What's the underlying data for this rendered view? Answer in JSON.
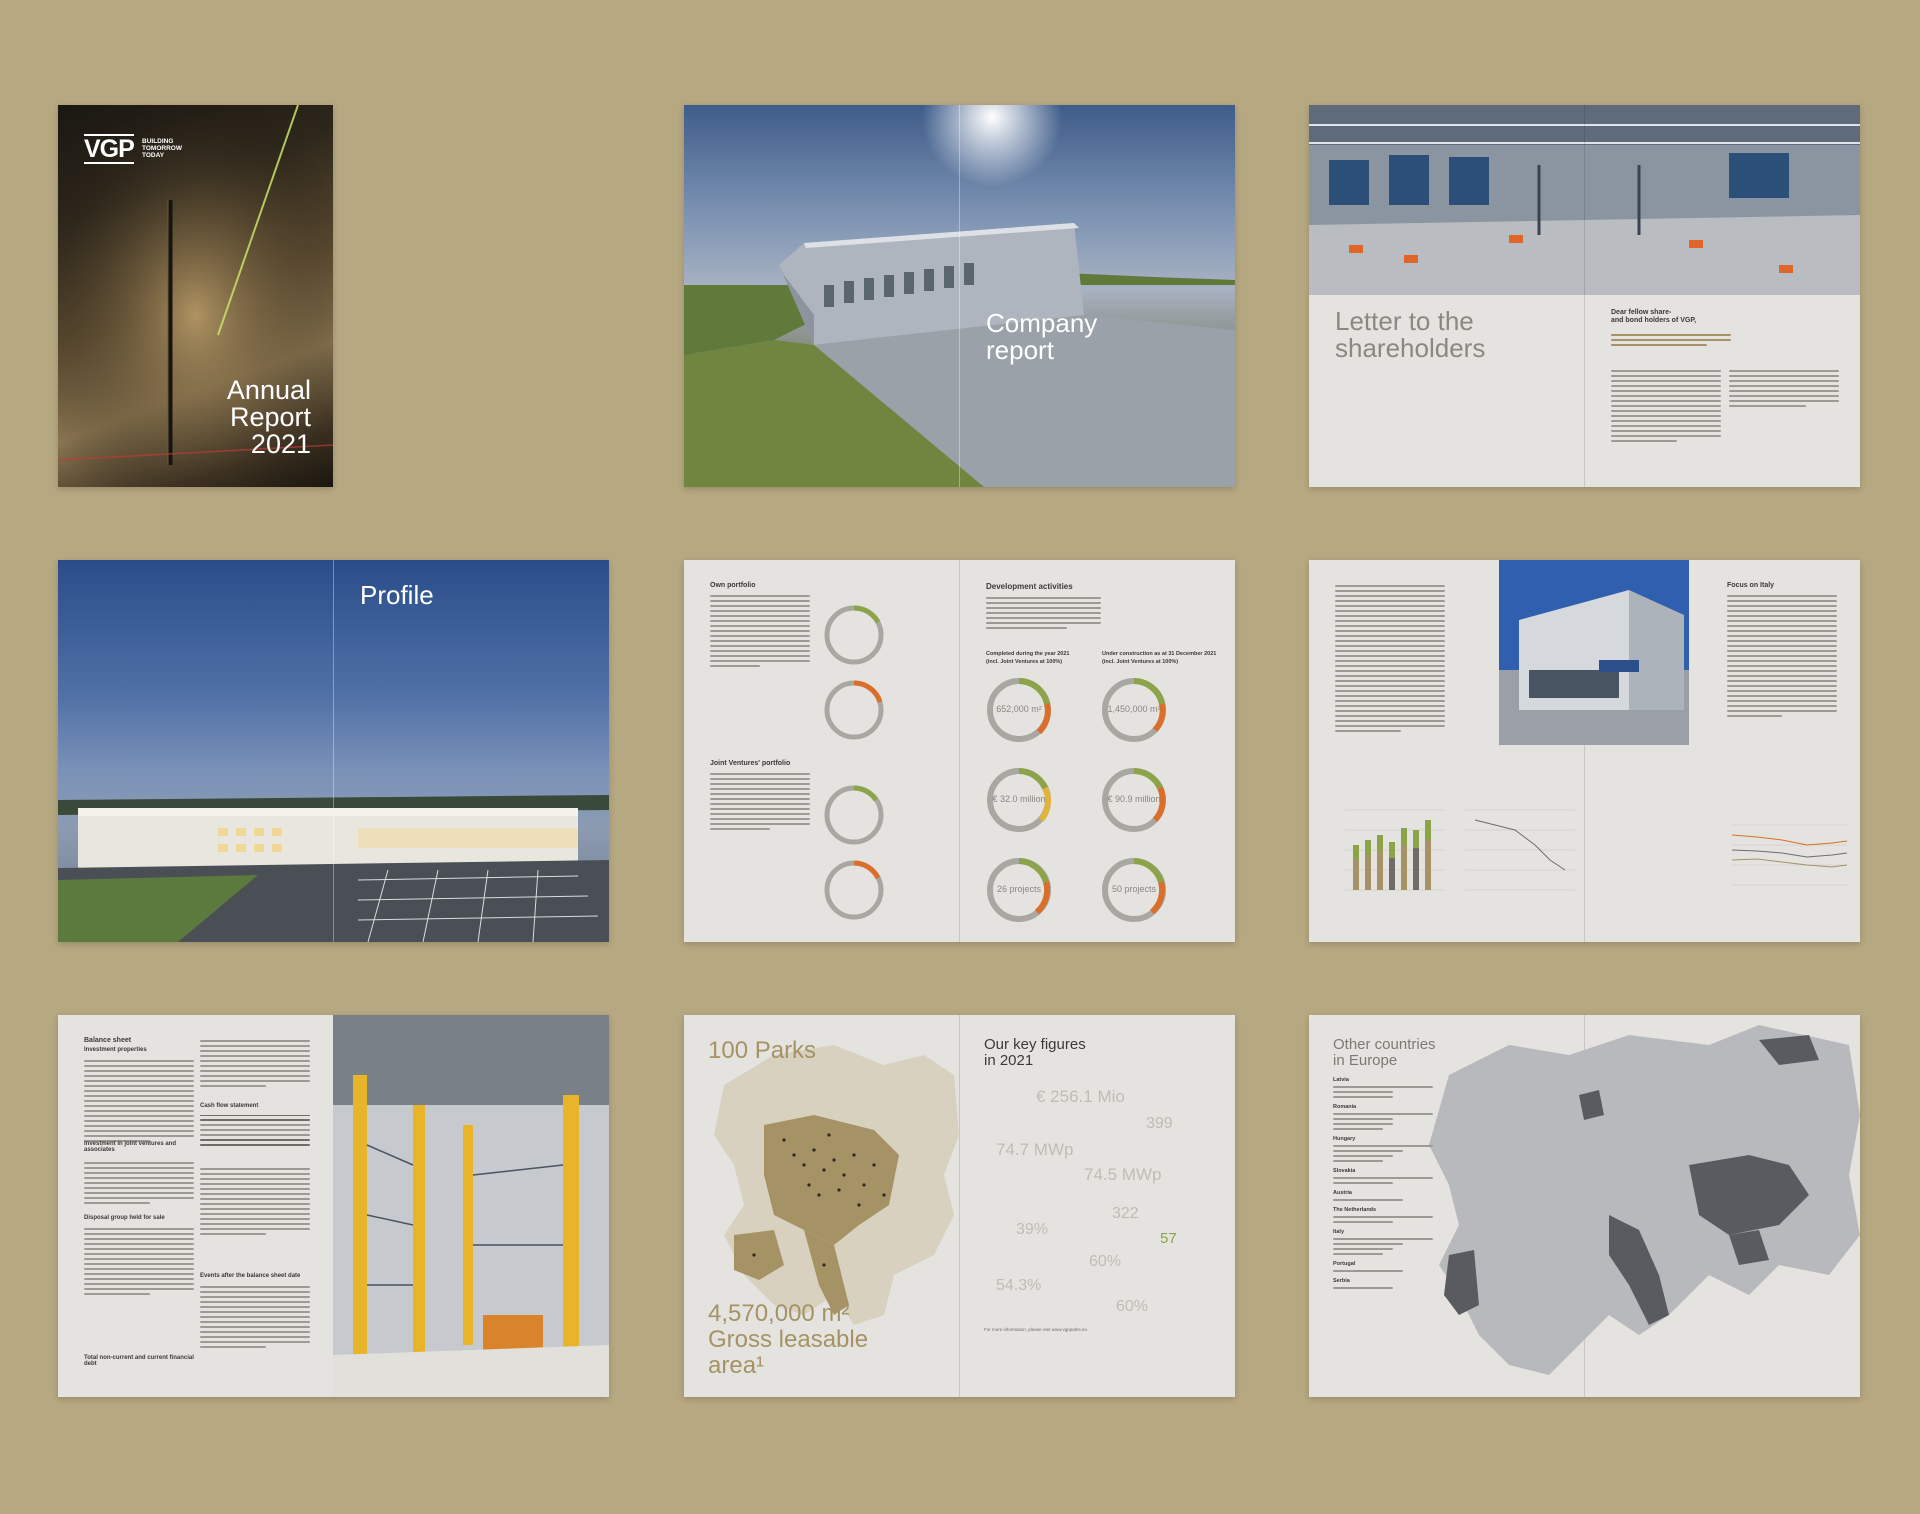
{
  "cover": {
    "logo": "VGP",
    "tagline": [
      "BUILDING",
      "TOMORROW",
      "TODAY"
    ],
    "title_lines": [
      "Annual",
      "Report",
      "2021"
    ]
  },
  "company_report": {
    "title_lines": [
      "Company",
      "report"
    ]
  },
  "letter": {
    "title_lines": [
      "Letter to the",
      "shareholders"
    ],
    "heading": "Dear fellow share-\nand bond holders of VGP,"
  },
  "profile": {
    "title": "Profile"
  },
  "portfolio": {
    "left_heading": "Own portfolio",
    "left_heading2": "Joint Ventures' portfolio",
    "right_heading": "Development activities",
    "right_sub1": "Completed during the year 2021\n(incl. Joint Ventures at 100%)",
    "right_sub2": "Under construction as at 31 December 2021\n(incl. Joint Ventures at 100%)",
    "donuts": [
      "652,000 m²",
      "1,450,000 m²",
      "€ 32.0 million",
      "€ 90.9 million",
      "26 projects",
      "50 projects"
    ]
  },
  "focus": {
    "heading": "Focus on Italy"
  },
  "balance": {
    "heading": "Balance sheet",
    "sub1": "Investment properties",
    "sub2": "Investment in joint ventures and associates",
    "sub3": "Disposal group held for sale",
    "sub4": "Total non-current and current financial debt",
    "sub5": "Cash flow statement",
    "sub6": "Events after the balance sheet date"
  },
  "key_figures": {
    "parks": "100 Parks",
    "gla": "4,570,000 m²\nGross leasable\narea¹",
    "title_lines": [
      "Our key figures",
      "in 2021"
    ],
    "metrics": [
      "€ 256.1 Mio",
      "399",
      "74.7 MWp",
      "74.5 MWp",
      "39%",
      "322",
      "57",
      "60%",
      "54.3%",
      "60%"
    ],
    "footnote": "For more information, please visit www.vgpparks.eu"
  },
  "other_countries": {
    "title_lines": [
      "Other countries",
      "in Europe"
    ],
    "countries": [
      "Latvia",
      "Romania",
      "Hungary",
      "Slovakia",
      "Austria",
      "The Netherlands",
      "Italy",
      "Portugal",
      "Serbia"
    ]
  },
  "colors": {
    "background": "#b6a881",
    "page": "#e4e3e0",
    "accent_gold": "#a59365",
    "donut_green": "#8ca34a",
    "donut_orange": "#d96f2a"
  }
}
